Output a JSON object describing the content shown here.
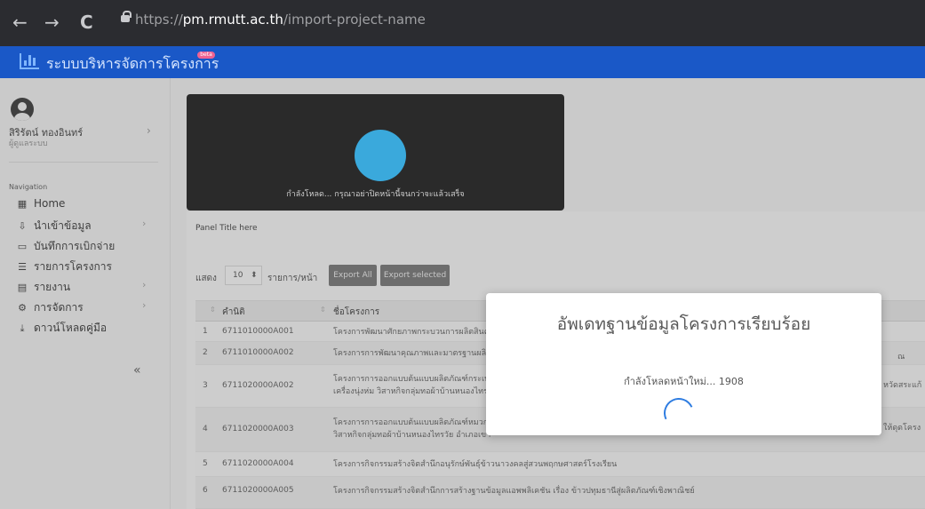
{
  "browser": {
    "back": "←",
    "forward": "→",
    "reload": "C",
    "url_scheme": "https://",
    "url_host": "pm.rmutt.ac.th",
    "url_path": "/import-project-name"
  },
  "app": {
    "title": "ระบบบริหารจัดการโครงการ",
    "badge": "beta"
  },
  "sidebar": {
    "user_name": "สิริรัตน์ ทองอินทร์",
    "user_role": "ผู้ดูแลระบบ",
    "nav_heading": "Navigation",
    "items": [
      {
        "label": "Home",
        "icon": "dashboard-icon",
        "glyph": "▦"
      },
      {
        "label": "นำเข้าข้อมูล",
        "icon": "import-icon",
        "glyph": "⇩",
        "has_children": true
      },
      {
        "label": "บันทึกการเบิกจ่าย",
        "icon": "card-icon",
        "glyph": "▭"
      },
      {
        "label": "รายการโครงการ",
        "icon": "list-icon",
        "glyph": "☰"
      },
      {
        "label": "รายงาน",
        "icon": "report-icon",
        "glyph": "▤",
        "has_children": true
      },
      {
        "label": "การจัดการ",
        "icon": "settings-icon",
        "glyph": "⚙",
        "has_children": true
      },
      {
        "label": "ดาวน์โหลดคู่มือ",
        "icon": "download-icon",
        "glyph": "⤓"
      }
    ],
    "collapse": "«"
  },
  "panel": {
    "title": "Panel Title here",
    "show_label": "แสดง",
    "page_size": "10",
    "per_page_label": "รายการ/หน้า",
    "export_all": "Export All",
    "export_selected": "Export selected",
    "columns": [
      "คำนิติ",
      "ชื่อโครงการ"
    ],
    "rows": [
      {
        "num": "1",
        "code": "6711010000A001",
        "name": "โครงการพัฒนาศักยภาพกระบวนการผลิตสินค้า"
      },
      {
        "num": "2",
        "code": "6711010000A002",
        "name": "โครงการการพัฒนาคุณภาพและมาตรฐานผลิต"
      },
      {
        "num": "3",
        "code": "6711020000A002",
        "name": "โครงการการออกแบบต้นแบบผลิตภัณฑ์กระเป๋า",
        "name2": "เครื่องนุ่งห่ม วิสาหกิจกลุ่มทอผ้าบ้านหนองไทร"
      },
      {
        "num": "4",
        "code": "6711020000A003",
        "name": "โครงการการออกแบบต้นแบบผลิตภัณฑ์หมวก",
        "name2": "วิสาหกิจกลุ่มทอผ้าบ้านหนองไทรวัย อำเภอเขา"
      },
      {
        "num": "5",
        "code": "6711020000A004",
        "name": "โครงการกิจกรรมสร้างจิตสำนึกอนุรักษ์พันธุ์ข้าวนาวงคลสู่สวนพฤกษศาสตร์โรงเรียน"
      },
      {
        "num": "6",
        "code": "6711020000A005",
        "name": "โครงการกิจกรรมสร้างจิตสำนึกการสร้างฐานข้อมูลแอพพลิเคชัน เรื่อง ข้าวปทุมธานีสู่ผลิตภัณฑ์เชิงพาณิชย์"
      }
    ],
    "overflow_right": [
      "ณ",
      "หวัดสระแก้",
      "ให้ดุดโครง"
    ]
  },
  "loading": {
    "text": "กำลังโหลด... กรุณาอย่าปิดหน้านี้จนกว่าจะแล้วเสร็จ"
  },
  "dialog": {
    "title": "อัพเดทฐานข้อมูลโครงการเรียบร้อย",
    "subtitle": "กำลังโหลดหน้าใหม่... 1908"
  },
  "colors": {
    "header_blue": "#1a58c7",
    "loading_circle": "#3aa9dc",
    "spinner": "#2f7de1"
  }
}
